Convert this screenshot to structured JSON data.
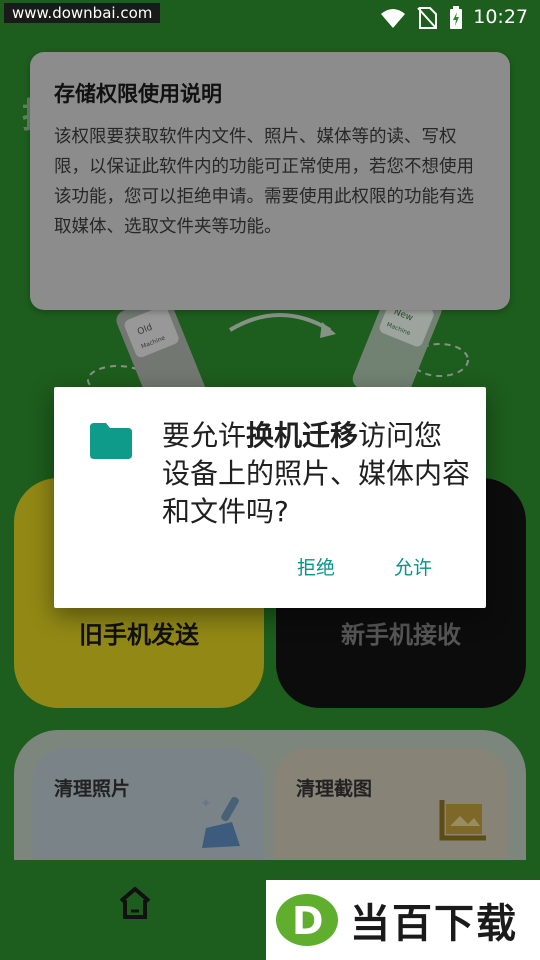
{
  "status_bar": {
    "url": "www.downbai.com",
    "time": "10:27"
  },
  "explain": {
    "title": "存储权限使用说明",
    "body": "该权限要获取软件内文件、照片、媒体等的读、写权限，以保证此软件内的功能可正常使用，若您不想使用该功能，您可以拒绝申请。需要使用此权限的功能有选取媒体、选取文件夹等功能。"
  },
  "dialog": {
    "msg_prefix": "要允许",
    "app_name": "换机迁移",
    "msg_suffix": "访问您设备上的照片、媒体内容和文件吗?",
    "deny_label": "拒绝",
    "allow_label": "允许"
  },
  "illustration": {
    "old_label": "Old",
    "new_label": "New",
    "machine_label": "Machine"
  },
  "cards": {
    "old_phone": "旧手机发送",
    "new_phone": "新手机接收"
  },
  "clean": {
    "photo": "清理照片",
    "screenshot": "清理截图"
  },
  "brand": {
    "name": "当百下载",
    "logo_letter": "D"
  },
  "colors": {
    "accent": "#009688",
    "app_green": "#2b8a2b",
    "old_card": "#d6c91f",
    "new_card": "#121212"
  }
}
